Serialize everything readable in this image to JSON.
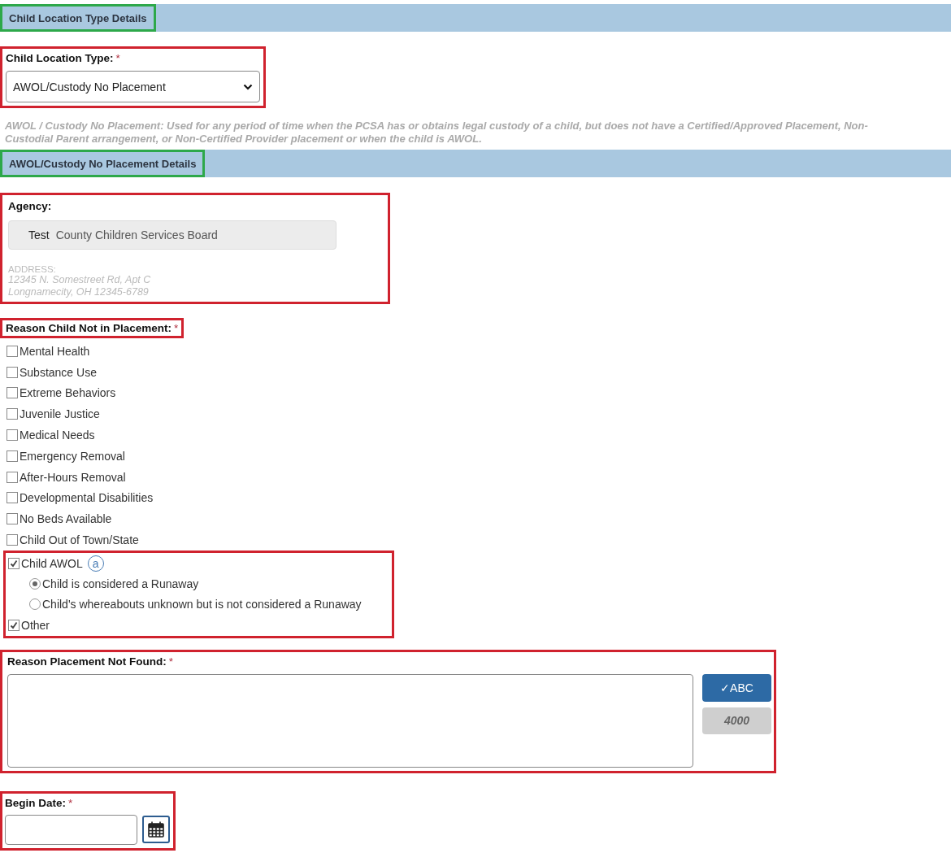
{
  "blocks": [
    {
      "kind": "header",
      "title": "Child Location Type Details",
      "color": "#2da84a"
    },
    {
      "kind": "select",
      "label": "Child Location Type:",
      "required_mark": "*",
      "value": "AWOL/Custody No Placement",
      "color": "#d0222e"
    },
    {
      "kind": "note",
      "text": "AWOL / Custody No Placement: Used for any period of time when the PCSA has or obtains legal custody of a child, but does not have a Certified/Approved Placement, Non-Custodial Parent arrangement, or Non-Certified Provider placement or when the child is AWOL."
    },
    {
      "kind": "header",
      "title": "AWOL/Custody No Placement Details",
      "color": "#2da84a"
    },
    {
      "kind": "agency",
      "label": "Agency:",
      "code": "Test",
      "name": "County Children Services Board",
      "address_label": "ADDRESS:",
      "address_lines": [
        "12345 N. Somestreet Rd, Apt C",
        "Longnamecity, OH 12345-6789"
      ],
      "color": "#d0222e"
    },
    {
      "kind": "checklist",
      "label": "Reason Child Not in Placement:",
      "required_mark": "*",
      "color": "#d0222e",
      "items": [
        {
          "kind": "check",
          "label": "Mental Health",
          "checked": false
        },
        {
          "kind": "check",
          "label": "Substance Use",
          "checked": false
        },
        {
          "kind": "check",
          "label": "Extreme Behaviors",
          "checked": false
        },
        {
          "kind": "check",
          "label": "Juvenile Justice",
          "checked": false
        },
        {
          "kind": "check",
          "label": "Medical Needs",
          "checked": false
        },
        {
          "kind": "check",
          "label": "Emergency Removal",
          "checked": false
        },
        {
          "kind": "check",
          "label": "After-Hours Removal",
          "checked": false
        },
        {
          "kind": "check",
          "label": "Developmental Disabilities",
          "checked": false
        },
        {
          "kind": "check",
          "label": "No Beds Available",
          "checked": false
        },
        {
          "kind": "check",
          "label": "Child Out of Town/State",
          "checked": false
        },
        {
          "kind": "group",
          "color": "#d0222e",
          "items": [
            {
              "kind": "check",
              "label": "Child AWOL",
              "checked": true,
              "info_icon": "a",
              "options": [
                {
                  "label": "Child is considered a Runaway",
                  "selected": true
                },
                {
                  "label": "Child's whereabouts unknown but is not considered a Runaway",
                  "selected": false
                }
              ]
            },
            {
              "kind": "check",
              "label": "Other",
              "checked": true
            }
          ]
        }
      ]
    },
    {
      "kind": "textarea",
      "label": "Reason Placement Not Found:",
      "required_mark": "*",
      "color": "#d0222e",
      "spell_button": "✓ABC",
      "counter": "4000"
    },
    {
      "kind": "date",
      "label": "Begin Date:",
      "required_mark": "*",
      "color": "#d0222e"
    }
  ]
}
